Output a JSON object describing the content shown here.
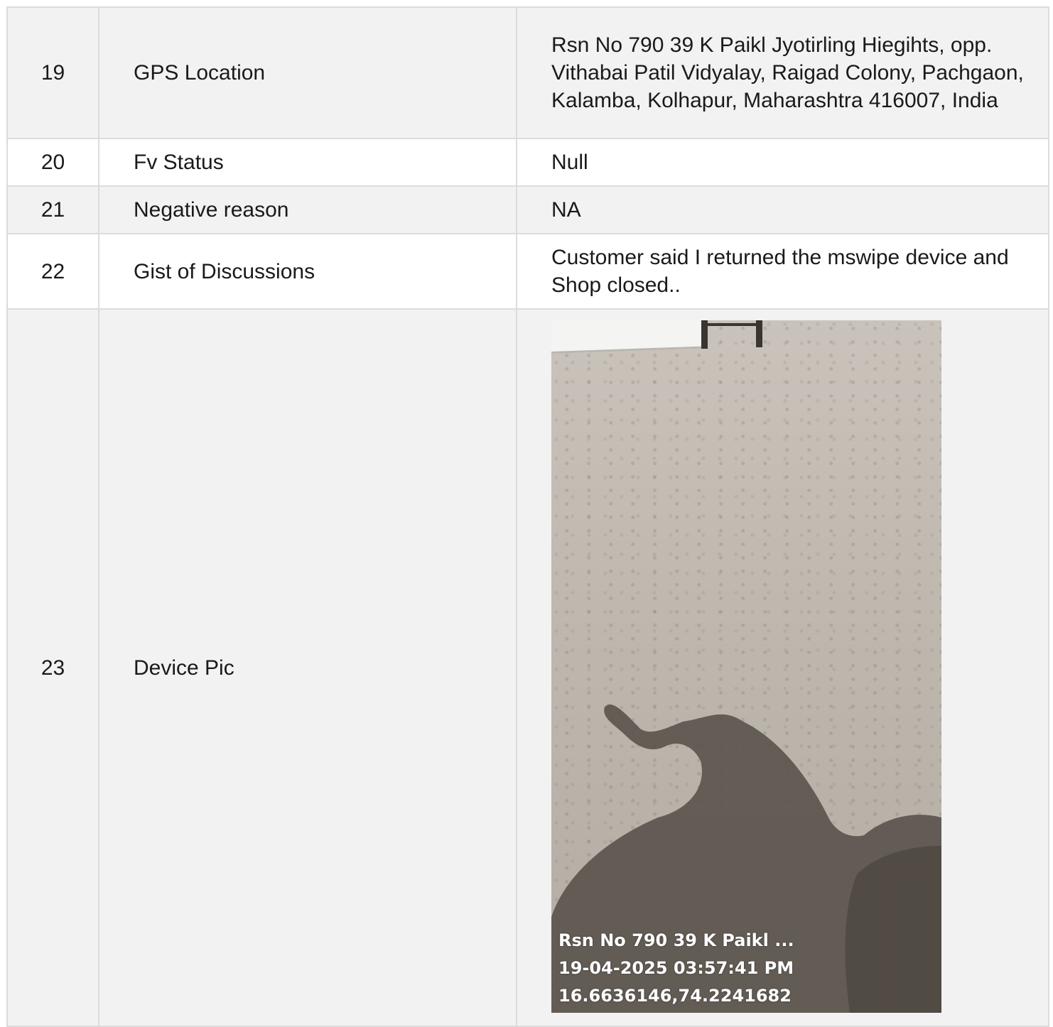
{
  "rows": [
    {
      "no": "19",
      "label": "GPS Location",
      "value": "Rsn No 790 39 K Paikl Jyotirling Hiegihts, opp. Vithabai Patil Vidyalay, Raigad Colony, Pachgaon, Kalamba, Kolhapur, Maharashtra 416007, India"
    },
    {
      "no": "20",
      "label": "Fv Status",
      "value": "Null"
    },
    {
      "no": "21",
      "label": "Negative reason",
      "value": "NA"
    },
    {
      "no": "22",
      "label": "Gist of Discussions",
      "value": "Customer said I returned the mswipe device and Shop closed.."
    },
    {
      "no": "23",
      "label": "Device Pic",
      "photo": {
        "stamp_address": "Rsn No 790 39 K Paikl ...",
        "stamp_datetime": "19-04-2025 03:57:41 PM",
        "stamp_coords": "16.6636146,74.2241682"
      }
    }
  ]
}
